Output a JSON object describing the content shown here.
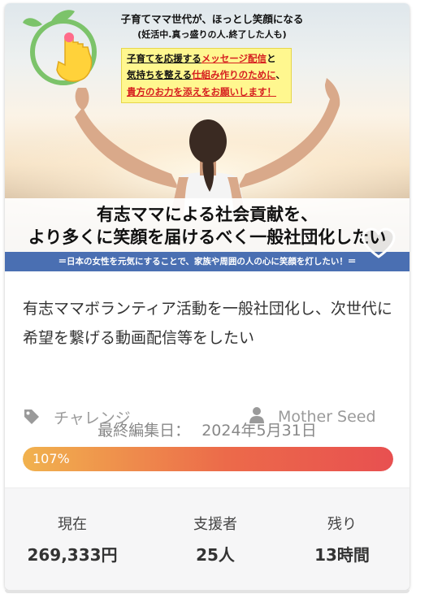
{
  "hero": {
    "headline_line1": "子育てママ世代が、ほっとし笑顔になる",
    "headline_line2": "(妊活中.真っ盛りの人.終了した人も)",
    "box_line1_a": "子育てを応援する",
    "box_line1_b": "メッセージ配信",
    "box_line1_c": "と",
    "box_line2_a": "気持ちを整える",
    "box_line2_b": "仕組み作りのために",
    "box_line2_c": "、",
    "box_line3": "貴方のお力を添えをお願いします！",
    "banner_line1": "有志ママによる社会貢献を、",
    "banner_line2": "より多くに笑顔を届けるべく一般社団化したい",
    "banner_sub": "＝日本の女性を元気にすることで、家族や周囲の人の心に笑顔を灯したい！＝"
  },
  "project": {
    "title": "有志ママボランティア活動を一般社団化し、次世代に希望を繋げる動画配信等をしたい",
    "category": "チャレンジ",
    "owner": "Mother Seed",
    "updated_label": "最終編集日：",
    "updated_date": "2024年5月31日",
    "progress_label": "107%",
    "progress_fraction": 1.0
  },
  "stats": {
    "current_label": "現在",
    "current_value": "269,333円",
    "supporters_label": "支援者",
    "supporters_value": "25人",
    "remaining_label": "残り",
    "remaining_value": "13時間"
  },
  "icons": {
    "tag": "tag-icon",
    "person": "person-icon",
    "heart": "heart-icon",
    "logo": "sprout-hand-logo"
  },
  "colors": {
    "progress_start": "#f1b24e",
    "progress_end": "#e85050",
    "banner_blue": "#4a6fb2",
    "highlight_yellow": "#fff78f"
  }
}
